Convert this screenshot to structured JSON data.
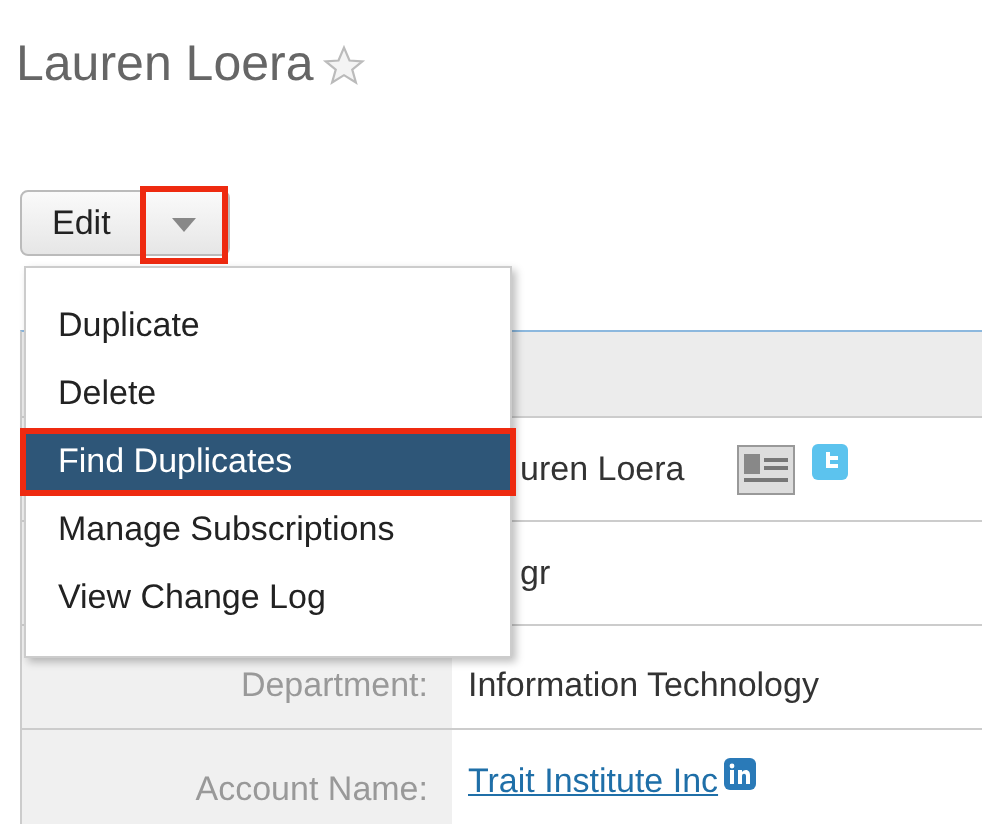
{
  "title": "Lauren Loera",
  "favorite": false,
  "edit_button": {
    "label": "Edit"
  },
  "menu": [
    {
      "label": "Duplicate",
      "selected": false
    },
    {
      "label": "Delete",
      "selected": false
    },
    {
      "label": "Find Duplicates",
      "selected": true
    },
    {
      "label": "Manage Subscriptions",
      "selected": false
    },
    {
      "label": "View Change Log",
      "selected": false
    }
  ],
  "rows": [
    {
      "kind": "name",
      "value": "uren Loera"
    },
    {
      "kind": "text",
      "value": "gr"
    },
    {
      "kind": "text",
      "label": "Department:",
      "value": "Information Technology"
    },
    {
      "kind": "link",
      "label": "Account Name:",
      "value": "Trait Institute Inc"
    }
  ]
}
